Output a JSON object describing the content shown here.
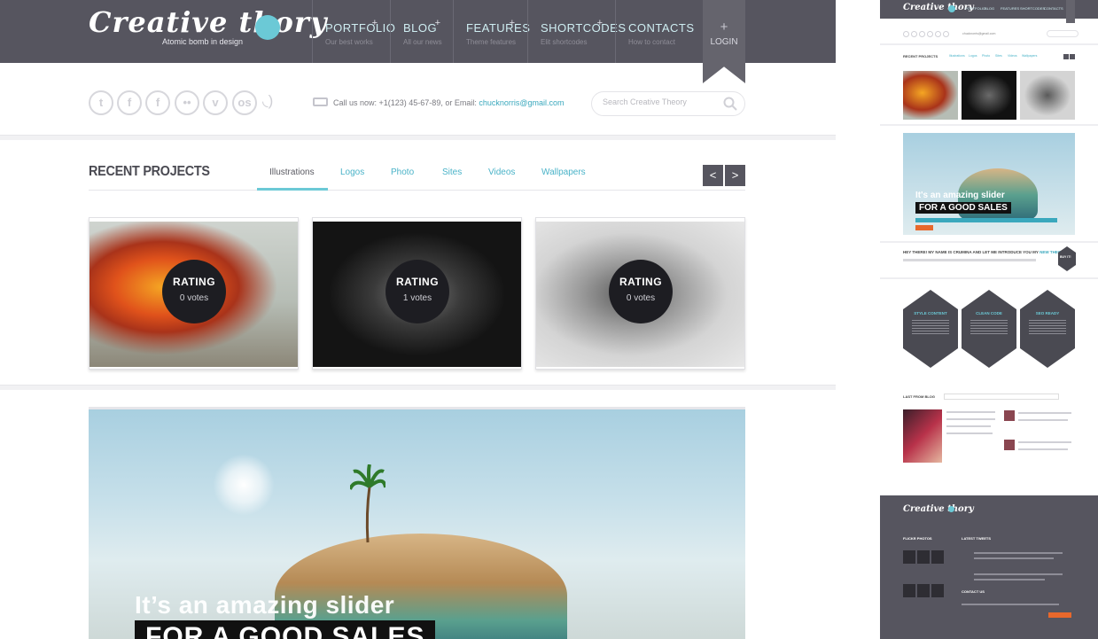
{
  "site": {
    "logo": "Creative thory",
    "tagline": "Atomic bomb in design",
    "accent_color": "#6bc9d6",
    "header_bg": "#56555f"
  },
  "nav": [
    {
      "label": "PORTFOLIO",
      "sub": "Our best works"
    },
    {
      "label": "BLOG",
      "sub": "All our news"
    },
    {
      "label": "FEATURES",
      "sub": "Theme features"
    },
    {
      "label": "SHORTCODES",
      "sub": "Elit shortcodes"
    },
    {
      "label": "CONTACTS",
      "sub": "How to contact"
    }
  ],
  "login": {
    "plus": "+",
    "label": "LOGIN"
  },
  "social_icons": [
    "twitter-icon",
    "facebook-icon",
    "facebook-icon",
    "flickr-icon",
    "vimeo-icon",
    "lastfm-icon",
    "rss-icon"
  ],
  "contact": {
    "prefix": "Call us now: +1(123) 45-67-89, or Email: ",
    "email": "chucknorris@gmail.com"
  },
  "search": {
    "placeholder": "Search Creative Theory"
  },
  "recent_projects": {
    "title": "RECENT PROJECTS",
    "tabs": [
      "Illustrations",
      "Logos",
      "Photo",
      "Sites",
      "Videos",
      "Wallpapers"
    ],
    "active_tab": "Illustrations",
    "prev": "<",
    "next": ">",
    "cards": [
      {
        "rating_label": "RATING",
        "votes": "0 votes"
      },
      {
        "rating_label": "RATING",
        "votes": "1 votes"
      },
      {
        "rating_label": "RATING",
        "votes": "0 votes"
      }
    ]
  },
  "slider": {
    "line1": "It’s an amazing slider",
    "line2": "FOR A GOOD SALES"
  },
  "mini": {
    "logo": "Creative thory",
    "nav": [
      "PORTFOLIO",
      "BLOG",
      "FEATURES",
      "SHORTCODES",
      "CONTACTS"
    ],
    "recent_projects": "RECENT PROJECTS",
    "tabs": [
      "Illustrations",
      "Logos",
      "Photo",
      "Sites",
      "Videos",
      "Wallpapers"
    ],
    "slider_line1": "It's an amazing slider",
    "slider_line2": "FOR A GOOD SALES",
    "intro_prefix": "HEY THERE! MY NAME IS CRUMINA AND LET ME INTRODUCE YOU MY ",
    "intro_highlight": "NEW THEORY",
    "buy": "BUY IT!",
    "features": [
      "STYLE CONTENT",
      "CLEAN CODE",
      "SEO READY"
    ],
    "blog_title": "LAST FROM BLOG",
    "footer_logo": "Creative thory",
    "flickr": "FLICKR PHOTOS",
    "tweets": "LATEST TWEETS",
    "contact_us": "CONTACT US"
  }
}
